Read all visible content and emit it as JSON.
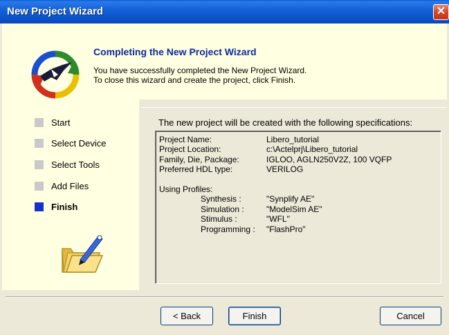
{
  "window": {
    "title": "New Project Wizard",
    "close_glyph": "✕"
  },
  "header": {
    "title": "Completing the New Project Wizard",
    "line1": "You have successfully completed the New Project Wizard.",
    "line2": "To close this wizard and create the project, click Finish.",
    "logo_icon": "libero-logo-icon"
  },
  "steps": [
    {
      "label": "Start",
      "active": false
    },
    {
      "label": "Select Device",
      "active": false
    },
    {
      "label": "Select Tools",
      "active": false
    },
    {
      "label": "Add Files",
      "active": false
    },
    {
      "label": "Finish",
      "active": true
    }
  ],
  "summary": {
    "heading": "The new project will be created with the following specifications:",
    "rows": [
      {
        "label": "Project Name:",
        "value": "Libero_tutorial"
      },
      {
        "label": "Project Location:",
        "value": "c:\\Actelprj\\Libero_tutorial"
      },
      {
        "label": "Family, Die, Package:",
        "value": "IGLOO, AGLN250V2Z, 100 VQFP"
      },
      {
        "label": "Preferred HDL type:",
        "value": "VERILOG"
      }
    ],
    "profiles_label": "Using Profiles:",
    "profiles": [
      {
        "label": "Synthesis :",
        "value": "\"Synplify AE\""
      },
      {
        "label": "Simulation :",
        "value": "\"ModelSim AE\""
      },
      {
        "label": "Stimulus :",
        "value": "\"WFL\""
      },
      {
        "label": "Programming :",
        "value": "\"FlashPro\""
      }
    ]
  },
  "buttons": {
    "back": "< Back",
    "finish": "Finish",
    "cancel": "Cancel"
  },
  "colors": {
    "titlebar": "#0b4fc6",
    "panel": "#ffffe1",
    "header_title": "#0a2a9c",
    "active_step": "#1431cc",
    "inactive_step": "#c9c9c9"
  }
}
